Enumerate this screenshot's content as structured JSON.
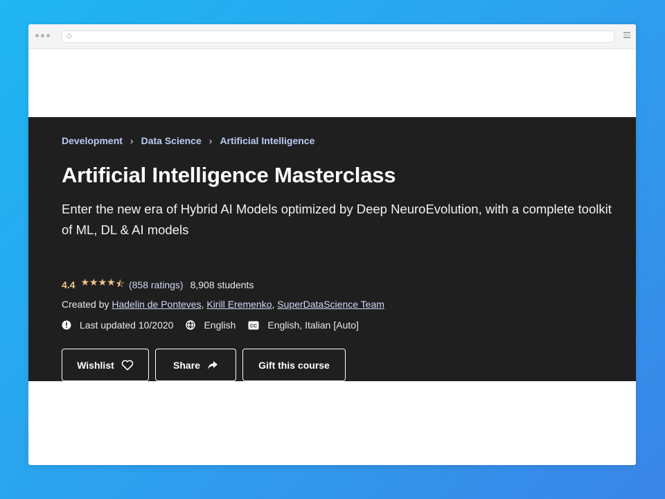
{
  "browser": {
    "address_icon": "page-icon"
  },
  "course": {
    "breadcrumb": [
      "Development",
      "Data Science",
      "Artificial Intelligence"
    ],
    "title": "Artificial Intelligence Masterclass",
    "subtitle": "Enter the new era of Hybrid AI Models optimized by Deep NeuroEvolution, with a complete toolkit of ML, DL & AI models",
    "rating": {
      "value": "4.4",
      "stars": 4.5,
      "ratings_text": "(858 ratings)",
      "students_text": "8,908 students"
    },
    "created": {
      "prefix": "Created by",
      "authors": [
        "Hadelin de Ponteves",
        "Kirill Eremenko",
        "SuperDataScience Team"
      ]
    },
    "meta": {
      "last_updated": "Last updated 10/2020",
      "language": "English",
      "captions": "English, Italian [Auto]"
    },
    "buttons": {
      "wishlist": "Wishlist",
      "share": "Share",
      "gift": "Gift this course"
    }
  },
  "colors": {
    "background_gradient_start": "#1fb6f2",
    "background_gradient_end": "#3a86e8",
    "hero_bg": "#1f1f1f",
    "breadcrumb": "#b9ccf5",
    "rating": "#f2c58a"
  }
}
